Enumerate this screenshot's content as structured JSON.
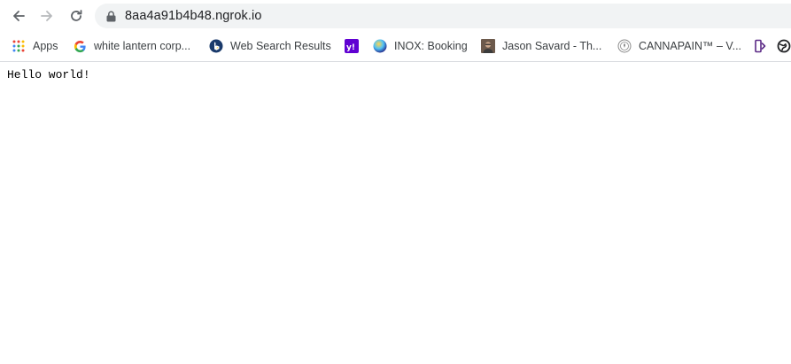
{
  "address_bar": {
    "url": "8aa4a91b4b48.ngrok.io"
  },
  "bookmarks": [
    {
      "label": "Apps",
      "icon": "apps-grid-icon"
    },
    {
      "label": "white lantern corp...",
      "icon": "google-g-icon"
    },
    {
      "label": "Web Search Results",
      "icon": "bing-b-icon"
    },
    {
      "label": "",
      "icon": "yahoo-icon"
    },
    {
      "label": "INOX: Booking",
      "icon": "inox-logo-icon"
    },
    {
      "label": "Jason Savard - Th...",
      "icon": "avatar-icon"
    },
    {
      "label": "CANNAPAIN™ – V...",
      "icon": "cannapain-icon"
    },
    {
      "label": "",
      "icon": "bookmark-partial-icon"
    },
    {
      "label": "",
      "icon": "globe-icon"
    }
  ],
  "page": {
    "body_text": "Hello world!"
  },
  "colors": {
    "omnibox_bg": "#f1f3f4",
    "toolbar_icon": "#5f6368",
    "yahoo_purple": "#6001d2"
  }
}
